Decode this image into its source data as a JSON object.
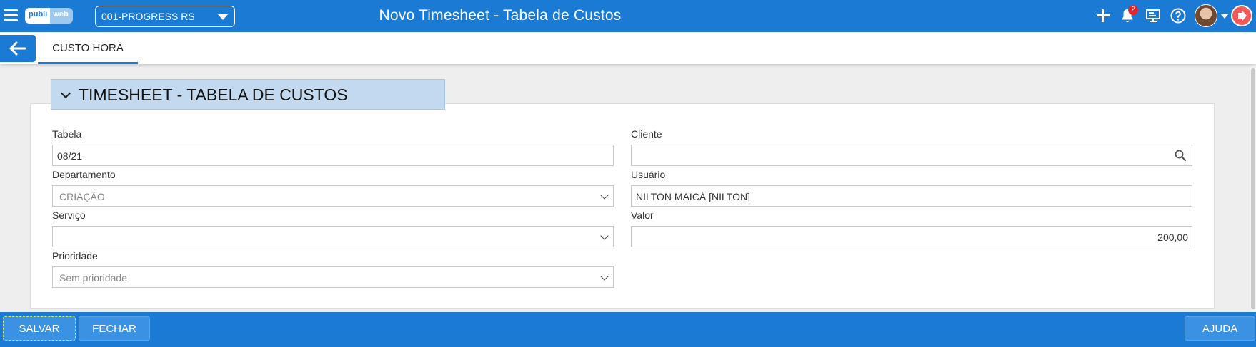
{
  "header": {
    "logo_part1": "publi",
    "logo_part2": "web",
    "company": "001-PROGRESS RS",
    "title": "Novo Timesheet - Tabela de Custos",
    "notification_count": "2"
  },
  "tabs": [
    {
      "label": "CUSTO HORA",
      "active": true
    }
  ],
  "section": {
    "title": "TIMESHEET - TABELA DE CUSTOS"
  },
  "form": {
    "tabela": {
      "label": "Tabela",
      "value": "08/21"
    },
    "cliente": {
      "label": "Cliente",
      "value": ""
    },
    "departamento": {
      "label": "Departamento",
      "value": "CRIAÇÃO"
    },
    "usuario": {
      "label": "Usuário",
      "value": "NILTON MAICÁ [NILTON]"
    },
    "servico": {
      "label": "Serviço",
      "value": ""
    },
    "valor": {
      "label": "Valor",
      "value": "200,00"
    },
    "prioridade": {
      "label": "Prioridade",
      "value": "Sem prioridade"
    }
  },
  "footer": {
    "save_label": "SALVAR",
    "close_label": "FECHAR",
    "help_label": "AJUDA"
  },
  "colors": {
    "primary": "#1a7ad4",
    "section_header_bg": "#c3d9ef",
    "badge": "#e0262e",
    "logout": "#f05a5a"
  }
}
